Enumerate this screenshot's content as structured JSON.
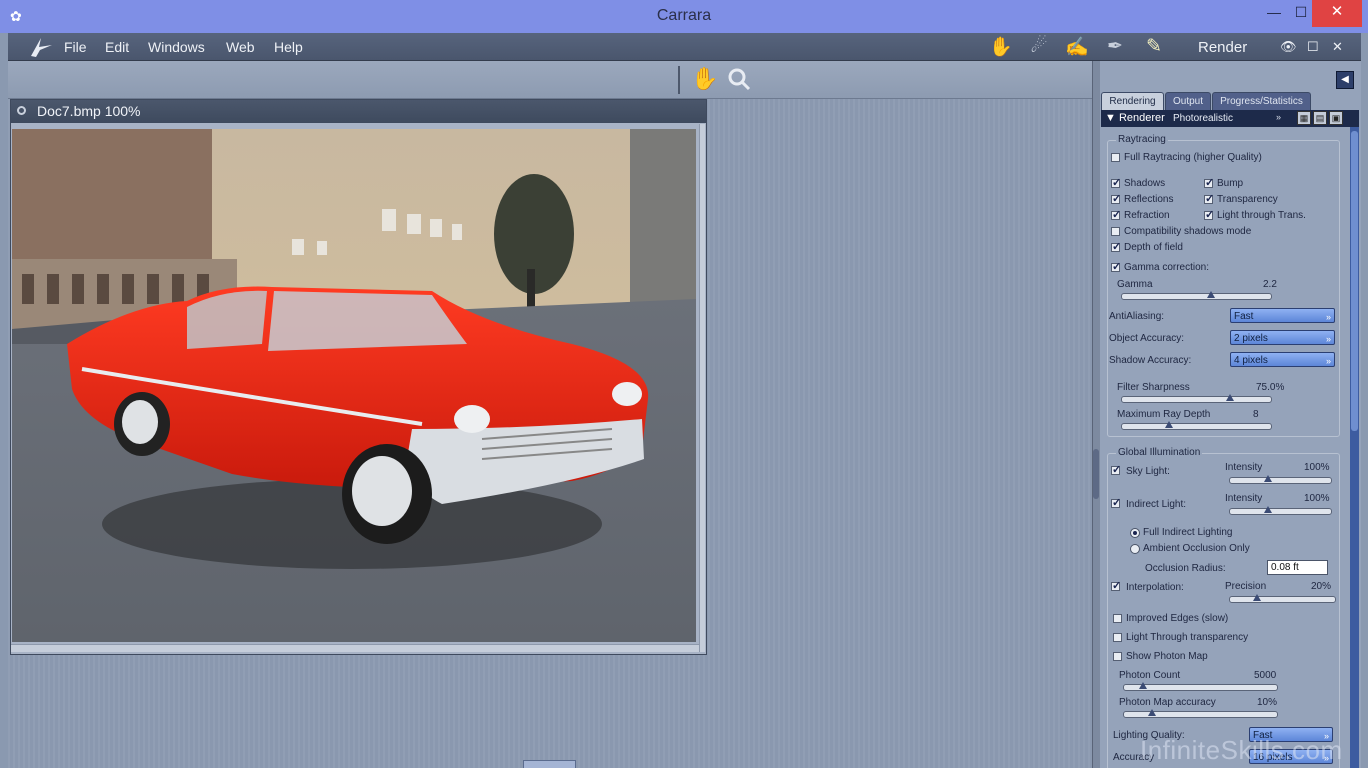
{
  "window": {
    "title": "Carrara",
    "minimize": "—",
    "maximize": "☐",
    "close": "✕"
  },
  "menu": {
    "items": [
      "File",
      "Edit",
      "Windows",
      "Web",
      "Help"
    ],
    "room": "Render",
    "eye": "👁",
    "restore": "☐",
    "close": "✕"
  },
  "document": {
    "title": "Doc7.bmp 100%"
  },
  "panel": {
    "tabs": [
      "Rendering",
      "Output",
      "Progress/Statistics"
    ],
    "renderer_label": "Renderer",
    "renderer_value": "Photorealistic",
    "raytracing": {
      "title": "Raytracing",
      "full_raytracing": {
        "label": "Full Raytracing (higher Quality)",
        "checked": false
      },
      "shadows": {
        "label": "Shadows",
        "checked": true
      },
      "bump": {
        "label": "Bump",
        "checked": true
      },
      "reflections": {
        "label": "Reflections",
        "checked": true
      },
      "transparency": {
        "label": "Transparency",
        "checked": true
      },
      "refraction": {
        "label": "Refraction",
        "checked": true
      },
      "light_through_trans": {
        "label": "Light through Trans.",
        "checked": true
      },
      "compat_shadows": {
        "label": "Compatibility shadows mode",
        "checked": false
      },
      "depth_of_field": {
        "label": "Depth of field",
        "checked": true
      },
      "gamma_correction": {
        "label": "Gamma correction:",
        "checked": true
      },
      "gamma_label": "Gamma",
      "gamma_value": "2.2",
      "gamma_level": 0.58,
      "antialiasing": {
        "label": "AntiAliasing:",
        "value": "Fast"
      },
      "object_accuracy": {
        "label": "Object Accuracy:",
        "value": "2 pixels"
      },
      "shadow_accuracy": {
        "label": "Shadow Accuracy:",
        "value": "4 pixels"
      },
      "filter_sharpness": {
        "label": "Filter Sharpness",
        "value": "75.0%",
        "level": 0.72
      },
      "max_ray_depth": {
        "label": "Maximum Ray Depth",
        "value": "8",
        "level": 0.28
      }
    },
    "gi": {
      "title": "Global Illumination",
      "sky_light": {
        "label": "Sky Light:",
        "checked": true,
        "intensity_label": "Intensity",
        "intensity": "100%",
        "level": 0.33
      },
      "indirect_light": {
        "label": "Indirect Light:",
        "checked": true,
        "intensity_label": "Intensity",
        "intensity": "100%",
        "level": 0.33
      },
      "full_indirect": {
        "label": "Full Indirect Lighting",
        "selected": true
      },
      "ambient_occlusion": {
        "label": "Ambient Occlusion Only",
        "selected": false
      },
      "occlusion_radius": {
        "label": "Occlusion Radius:",
        "value": "0.08 ft"
      },
      "interpolation": {
        "label": "Interpolation:",
        "checked": true,
        "precision_label": "Precision",
        "precision": "20%",
        "level": 0.2
      },
      "improved_edges": {
        "label": "Improved Edges (slow)",
        "checked": false
      },
      "light_through_transparency": {
        "label": "Light Through transparency",
        "checked": false
      },
      "show_photon_map": {
        "label": "Show Photon Map",
        "checked": false
      },
      "photon_count": {
        "label": "Photon Count",
        "value": "5000",
        "level": 0.08
      },
      "photon_map_accuracy": {
        "label": "Photon Map accuracy",
        "value": "10%",
        "level": 0.14
      },
      "lighting_quality": {
        "label": "Lighting Quality:",
        "value": "Fast"
      },
      "accuracy": {
        "label": "Accuracy",
        "value": "16 pixels"
      }
    }
  },
  "watermark": "InfiniteSkills.com"
}
